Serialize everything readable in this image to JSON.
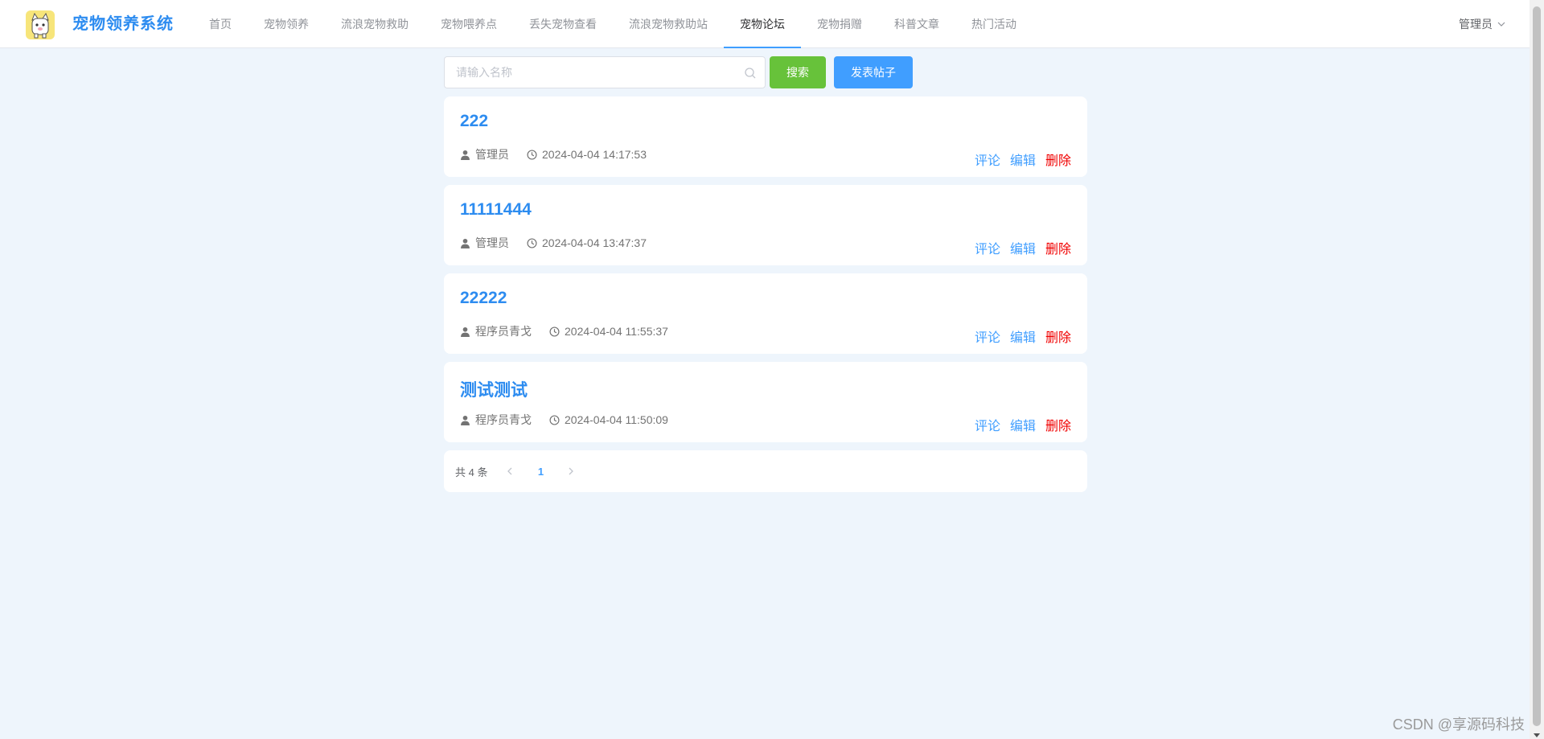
{
  "app": {
    "brand": "宠物领养系统"
  },
  "nav": [
    {
      "label": "首页",
      "active": false
    },
    {
      "label": "宠物领养",
      "active": false
    },
    {
      "label": "流浪宠物救助",
      "active": false
    },
    {
      "label": "宠物喂养点",
      "active": false
    },
    {
      "label": "丢失宠物查看",
      "active": false
    },
    {
      "label": "流浪宠物救助站",
      "active": false
    },
    {
      "label": "宠物论坛",
      "active": true
    },
    {
      "label": "宠物捐赠",
      "active": false
    },
    {
      "label": "科普文章",
      "active": false
    },
    {
      "label": "热门活动",
      "active": false
    }
  ],
  "user": {
    "name": "管理员"
  },
  "search": {
    "placeholder": "请输入名称",
    "value": "",
    "search_label": "搜索",
    "post_label": "发表帖子"
  },
  "posts": [
    {
      "title": "222",
      "author": "管理员",
      "time": "2024-04-04 14:17:53"
    },
    {
      "title": "11111444",
      "author": "管理员",
      "time": "2024-04-04 13:47:37"
    },
    {
      "title": "22222",
      "author": "程序员青戈",
      "time": "2024-04-04 11:55:37"
    },
    {
      "title": "测试测试",
      "author": "程序员青戈",
      "time": "2024-04-04 11:50:09"
    }
  ],
  "actions": {
    "comment": "评论",
    "edit": "编辑",
    "delete": "删除"
  },
  "pagination": {
    "total_text": "共 4 条",
    "current_page": "1"
  },
  "watermark": "CSDN @享源码科技",
  "colors": {
    "accent": "#409eff",
    "brand": "#2d8cf0",
    "success": "#67c23a",
    "danger": "#f00000",
    "background": "#eef5fc"
  }
}
